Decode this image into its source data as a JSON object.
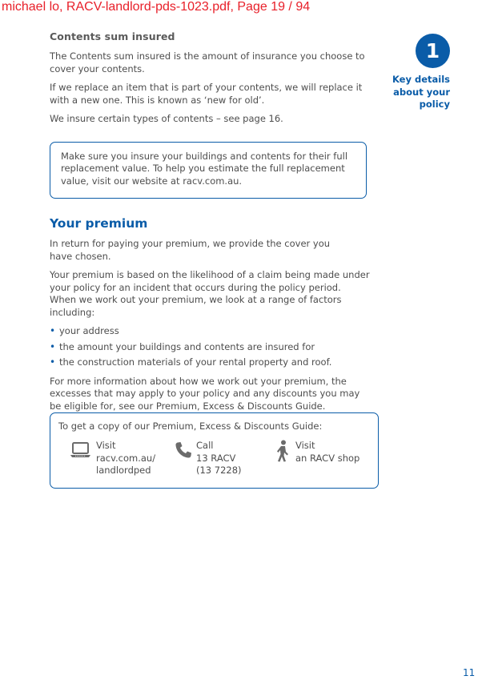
{
  "header": {
    "text": "michael lo, RACV-landlord-pds-1023.pdf, Page 19 / 94"
  },
  "contents_section": {
    "heading": "Contents sum insured",
    "paragraphs": [
      "The Contents sum insured is the amount of insurance you choose to cover your contents.",
      "If we replace an item that is part of your contents, we will replace it with a new one. This is known as ‘new for old’.",
      "We insure certain types of contents – see page 16."
    ]
  },
  "callout": {
    "text": "Make sure you insure your buildings and contents for their full replacement value. To help you estimate the full replacement value, visit our website at racv.com.au."
  },
  "premium_section": {
    "heading": "Your premium",
    "paragraphs": [
      "In return for paying your premium, we provide the cover you have chosen.",
      "Your premium is based on the likelihood of a claim being made under your policy for an incident that occurs during the policy period. When we work out your premium, we look at a range of factors including:"
    ],
    "bullets": [
      "your address",
      "the amount your buildings and contents are insured for",
      "the construction materials of your rental property and roof."
    ],
    "closing": "For more information about how we work out your premium, the excesses that may apply to your policy and any discounts you may be eligible for, see our Premium, Excess & Discounts Guide."
  },
  "guide_box": {
    "intro": "To get a copy of our Premium, Excess & Discounts Guide:",
    "options": [
      {
        "icon": "laptop-icon",
        "lines": [
          "Visit",
          "racv.com.au/",
          "landlordped"
        ]
      },
      {
        "icon": "phone-icon",
        "lines": [
          "Call",
          "13 RACV",
          "(13 7228)"
        ]
      },
      {
        "icon": "walking-person-icon",
        "lines": [
          "Visit",
          "an RACV shop"
        ]
      }
    ]
  },
  "side_tab": {
    "number": "1",
    "label_lines": [
      "Key details",
      "about your",
      "policy"
    ]
  },
  "footer": {
    "page_number": "11"
  },
  "colors": {
    "brand_blue": "#0a5ca8",
    "header_red": "#e8202a",
    "body_text": "#4d4d4d"
  }
}
